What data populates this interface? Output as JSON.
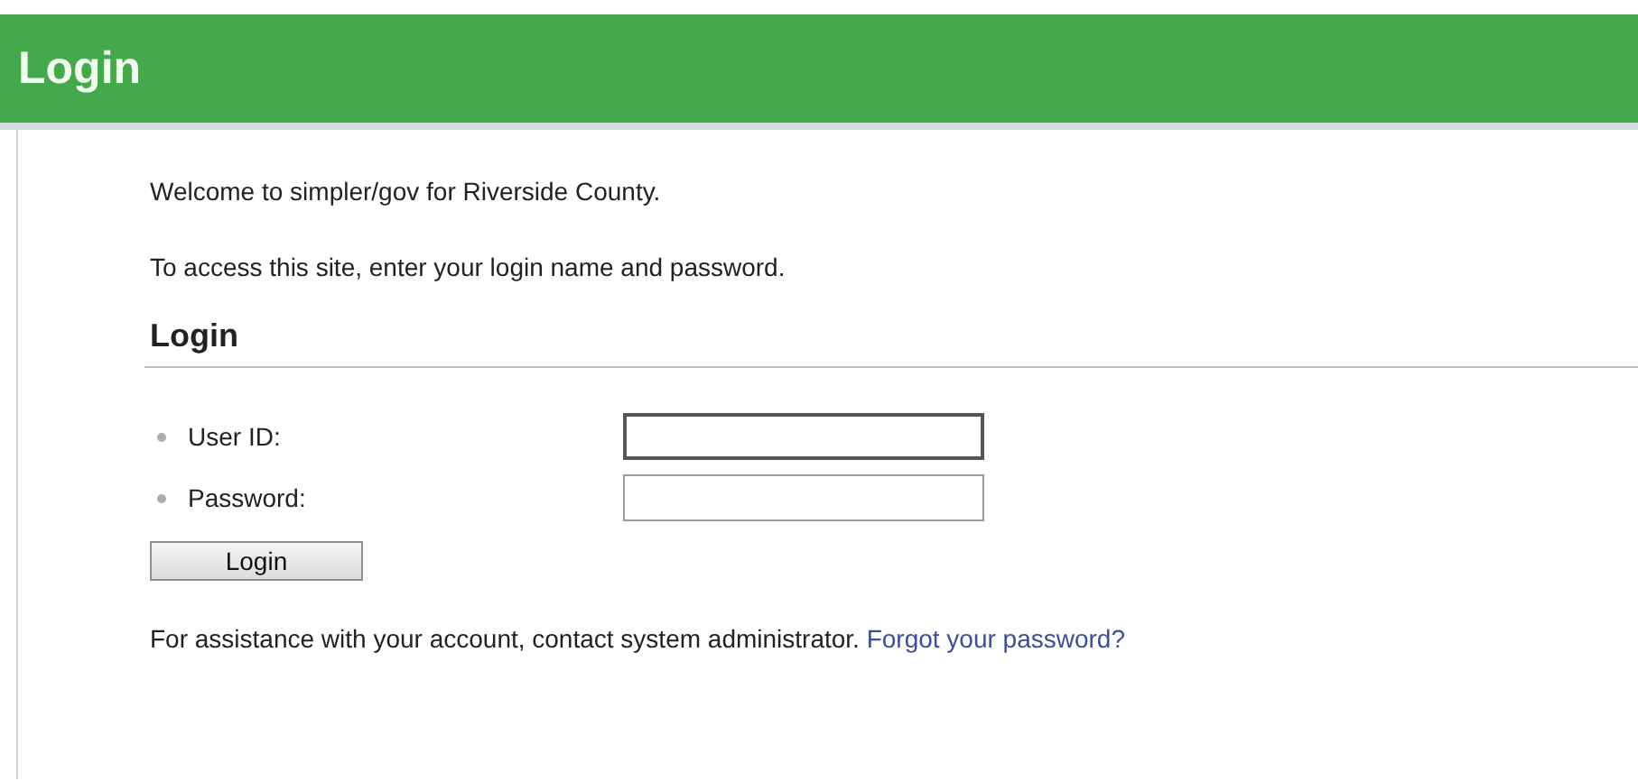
{
  "header": {
    "title": "Login"
  },
  "intro": [
    "Welcome to simpler/gov for Riverside County.",
    "To access this site, enter your login name and password."
  ],
  "section_title": "Login",
  "fields": [
    {
      "label": "User ID:",
      "required": true,
      "focused": true
    },
    {
      "label": "Password:",
      "required": true,
      "focused": false
    }
  ],
  "button": "Login",
  "help": {
    "text": "For assistance with your account, contact system administrator.",
    "link": "Forgot your password?"
  }
}
